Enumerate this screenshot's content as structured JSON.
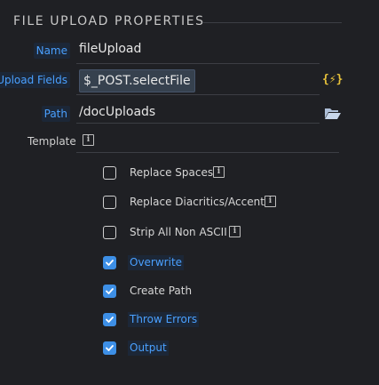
{
  "section": {
    "title": "FILE UPLOAD PROPERTIES"
  },
  "name_field": {
    "label": "Name",
    "value": "fileUpload"
  },
  "upload_fields": {
    "label": "Upload Fields",
    "value": "$_POST.selectFile",
    "dynamic_icon": "{⚡}"
  },
  "path_field": {
    "label": "Path",
    "value": "/docUploads"
  },
  "template": {
    "label": "Template"
  },
  "options": [
    {
      "label": "Replace Spaces",
      "checked": false,
      "info": true,
      "highlighted": false
    },
    {
      "label": "Replace Diacritics/Accent",
      "checked": false,
      "info": true,
      "highlighted": false
    },
    {
      "label": "Strip All Non ASCII",
      "checked": false,
      "info": true,
      "highlighted": false
    },
    {
      "label": "Overwrite",
      "checked": true,
      "info": false,
      "highlighted": true
    },
    {
      "label": "Create Path",
      "checked": true,
      "info": false,
      "highlighted": false
    },
    {
      "label": "Throw Errors",
      "checked": true,
      "info": false,
      "highlighted": true
    },
    {
      "label": "Output",
      "checked": true,
      "info": false,
      "highlighted": true
    }
  ],
  "colors": {
    "accent": "#4aa0ff",
    "checkbox_checked": "#3d8fe6",
    "background": "#1f2024",
    "dynamic_icon": "#e8c23a"
  }
}
